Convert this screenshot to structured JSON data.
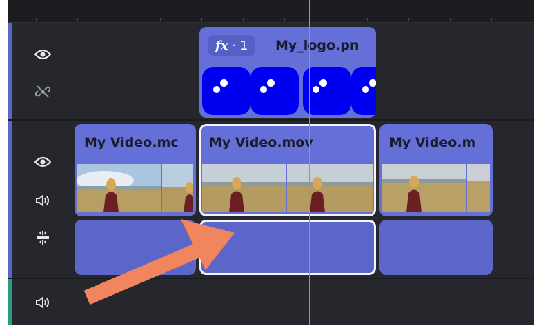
{
  "timeline": {
    "overlay_track": {
      "icons": [
        "eye-icon",
        "unlink-icon"
      ],
      "clip": {
        "fx_symbol": "fx",
        "fx_count": "· 1",
        "name": "My_logo.pn"
      }
    },
    "video_track": {
      "icons": [
        "eye-icon",
        "speaker-icon",
        "split-audio-icon"
      ],
      "clips": [
        {
          "name": "My Video.mc"
        },
        {
          "name": "My Video.mov"
        },
        {
          "name": "My Video.m"
        }
      ]
    },
    "audio_track": {
      "icons": [
        "speaker-icon"
      ]
    }
  },
  "colors": {
    "clip": "#6470d8",
    "track_bar_video": "#5b66c8",
    "track_bar_audio": "#2a9d85",
    "logo_bg": "#0000f0",
    "playhead": "#f07a3a",
    "annotation_arrow": "#f0855e"
  }
}
